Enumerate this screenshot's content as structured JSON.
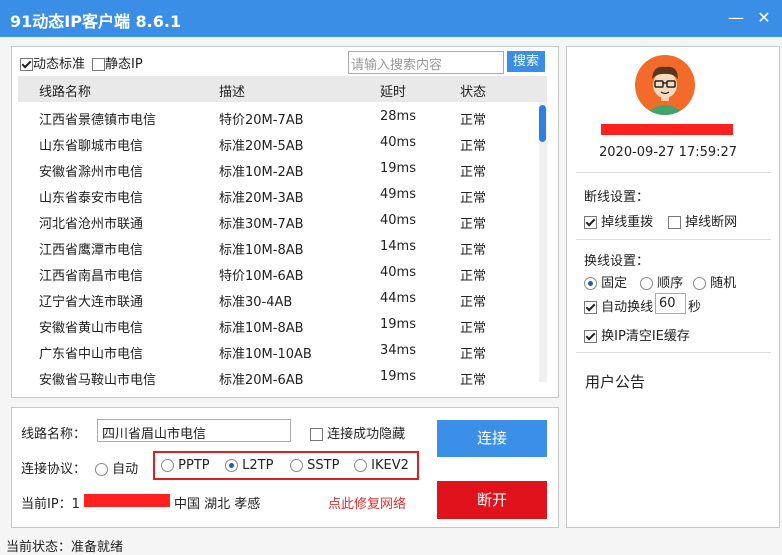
{
  "window": {
    "title": "91动态IP客户端 8.6.1",
    "minimize": "—",
    "close": "✕"
  },
  "filter": {
    "dynamic_label": "动态标准",
    "static_label": "静态IP",
    "search_placeholder": "请输入搜索内容",
    "search_button": "搜索"
  },
  "table": {
    "headers": [
      "线路名称",
      "描述",
      "延时",
      "状态"
    ],
    "rows": [
      [
        "江西省景德镇市电信",
        "特价20M-7AB",
        "28ms",
        "正常"
      ],
      [
        "山东省聊城市电信",
        "标准20M-5AB",
        "40ms",
        "正常"
      ],
      [
        "安徽省滁州市电信",
        "标准10M-2AB",
        "19ms",
        "正常"
      ],
      [
        "山东省泰安市电信",
        "标准20M-3AB",
        "49ms",
        "正常"
      ],
      [
        "河北省沧州市联通",
        "标准30M-7AB",
        "40ms",
        "正常"
      ],
      [
        "江西省鹰潭市电信",
        "标准10M-8AB",
        "14ms",
        "正常"
      ],
      [
        "江西省南昌市电信",
        "特价10M-6AB",
        "40ms",
        "正常"
      ],
      [
        "辽宁省大连市联通",
        "标准30-4AB",
        "44ms",
        "正常"
      ],
      [
        "安徽省黄山市电信",
        "标准10M-8AB",
        "19ms",
        "正常"
      ],
      [
        "广东省中山市电信",
        "标准10M-10AB",
        "34ms",
        "正常"
      ],
      [
        "安徽省马鞍山市电信",
        "标准20M-6AB",
        "19ms",
        "正常"
      ]
    ]
  },
  "connect": {
    "line_name_label": "线路名称：",
    "line_name_value": "四川省眉山市电信",
    "hide_on_success": "连接成功隐藏",
    "protocol_label": "连接协议：",
    "protocols": [
      "自动",
      "PPTP",
      "L2TP",
      "SSTP",
      "IKEV2"
    ],
    "connect_button": "连接",
    "current_ip_label": "当前IP：1",
    "ip_location": "中国 湖北 孝感",
    "repair_link": "点此修复网络",
    "disconnect_button": "断开"
  },
  "status": {
    "text": "当前状态：准备就绪"
  },
  "profile": {
    "datetime": "2020-09-27 17:59:27",
    "disconnect_settings_title": "断线设置：",
    "redial_label": "掉线重拨",
    "cut_network_label": "掉线断网",
    "switch_settings_title": "换线设置：",
    "mode_fixed": "固定",
    "mode_sequential": "顺序",
    "mode_random": "随机",
    "auto_switch_label": "自动换线",
    "auto_switch_value": "60",
    "seconds_unit": "秒",
    "clear_ie_cache_label": "换IP清空IE缓存",
    "announcement_title": "用户公告"
  },
  "colors": {
    "accent": "#3a8ee6",
    "connect_btn": "#3b8fe8",
    "disconnect_btn": "#e0121c",
    "redact": "#ff2020"
  }
}
